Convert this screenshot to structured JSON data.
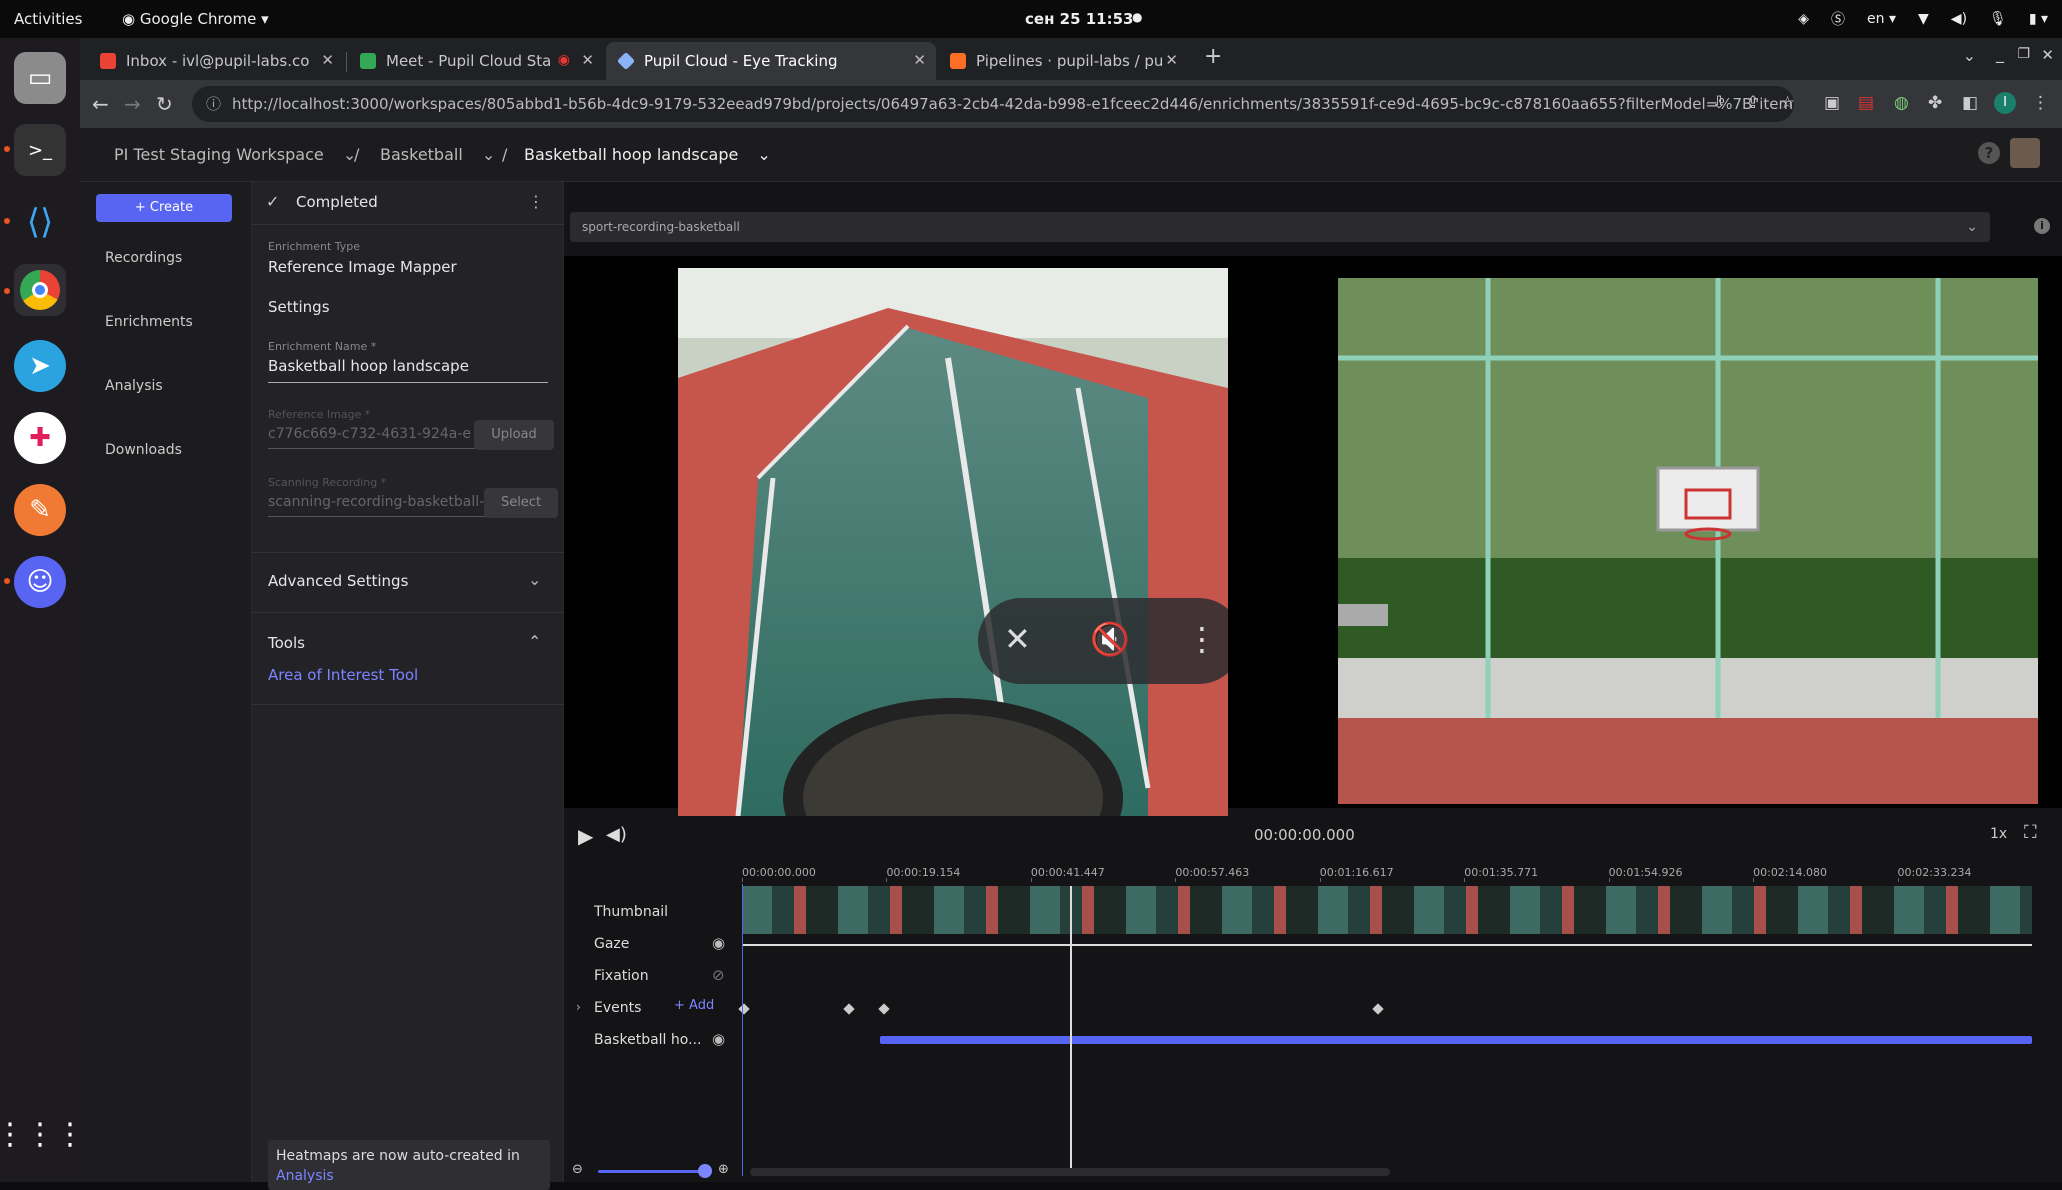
{
  "os": {
    "activities": "Activities",
    "app_name": "Google Chrome",
    "clock": "сен 25  11:53",
    "lang": "en"
  },
  "browser": {
    "tabs": [
      {
        "title": "Inbox - ivl@pupil-labs.co",
        "favicon_color": "#ea4335"
      },
      {
        "title": "Meet - Pupil Cloud Sta",
        "favicon_color": "#34a853"
      },
      {
        "title": "Pupil Cloud - Eye Tracking",
        "favicon_color": "#8ab4f8"
      },
      {
        "title": "Pipelines · pupil-labs / pu",
        "favicon_color": "#fc6d26"
      }
    ],
    "url": "http://localhost:3000/workspaces/805abbd1-b56b-4dc9-9179-532eead979bd/projects/06497a63-2cb4-42da-b998-e1fceec2d446/enrichments/3835591f-ce9d-4695-bc9c-c878160aa655?filterModel=%7B\"items\"%3A..."
  },
  "header": {
    "workspace": "PI Test Staging Workspace",
    "project": "Basketball",
    "enrichment": "Basketball hoop landscape"
  },
  "leftnav": {
    "create_label": "Create",
    "items": [
      "Recordings",
      "Enrichments",
      "Analysis",
      "Downloads"
    ]
  },
  "settings": {
    "status": "Completed",
    "type_label": "Enrichment Type",
    "type_value": "Reference Image Mapper",
    "section_title": "Settings",
    "name_label": "Enrichment Name *",
    "name_value": "Basketball hoop landscape",
    "ref_label": "Reference Image *",
    "ref_value": "c776c669-c732-4631-924a-e",
    "upload_label": "Upload",
    "scan_label": "Scanning Recording *",
    "scan_value": "scanning-recording-basketball-",
    "select_label": "Select",
    "advanced_label": "Advanced Settings",
    "tools_label": "Tools",
    "aoi_tool": "Area of Interest Tool",
    "notice_text": "Heatmaps are now auto-created in",
    "notice_link": "Analysis"
  },
  "player": {
    "recording": "sport-recording-basketball",
    "time": "00:00:00.000",
    "speed": "1x"
  },
  "timeline": {
    "ticks": [
      "00:00:00.000",
      "00:00:19.154",
      "00:00:41.447",
      "00:00:57.463",
      "00:01:16.617",
      "00:01:35.771",
      "00:01:54.926",
      "00:02:14.080",
      "00:02:33.234"
    ],
    "tracks": {
      "thumbnail": "Thumbnail",
      "gaze": "Gaze",
      "fixation": "Fixation",
      "events": "Events",
      "add_label": "Add",
      "enrichment": "Basketball ho..."
    },
    "accent": "#5865f2"
  }
}
